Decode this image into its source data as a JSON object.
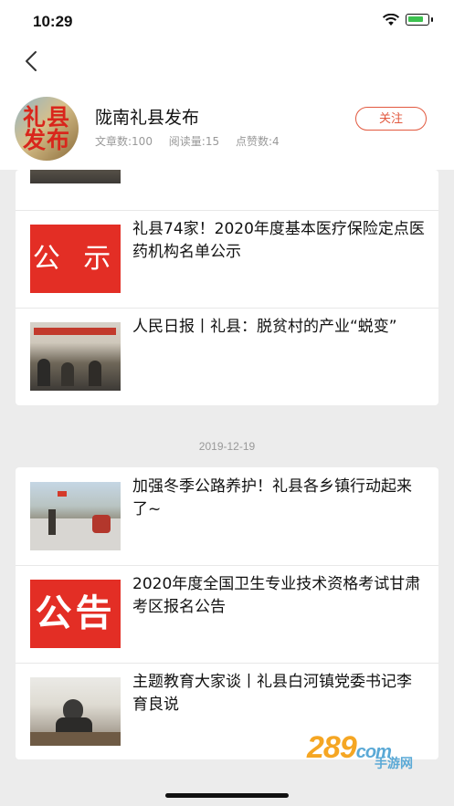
{
  "status_bar": {
    "time": "10:29"
  },
  "account": {
    "avatar_text": "礼县\n发布",
    "name": "陇南礼县发布",
    "stats": {
      "articles": "文章数:100",
      "reads": "阅读量:15",
      "likes": "点赞数:4"
    },
    "follow_label": "关注",
    "accent_color": "#e2593f"
  },
  "groups": [
    {
      "date": "",
      "articles": [
        {
          "title": "",
          "thumb": "photo-meeting"
        },
        {
          "title": "礼县74家！2020年度基本医疗保险定点医药机构名单公示",
          "thumb": "notice",
          "thumb_text": "公 示"
        },
        {
          "title": "人民日报丨礼县：脱贫村的产业“蜕变”",
          "thumb": "photo-meeting"
        }
      ]
    },
    {
      "date": "2019-12-19",
      "articles": [
        {
          "title": "加强冬季公路养护！礼县各乡镇行动起来了~",
          "thumb": "photo-road"
        },
        {
          "title": "2020年度全国卫生专业技术资格考试甘肃考区报名公告",
          "thumb": "notice",
          "thumb_text": "公告"
        },
        {
          "title": "主题教育大家谈丨礼县白河镇党委书记李育良说",
          "thumb": "photo-office"
        }
      ]
    }
  ],
  "watermark": {
    "brand": "289",
    "suffix": "com",
    "sub": "手游网"
  }
}
